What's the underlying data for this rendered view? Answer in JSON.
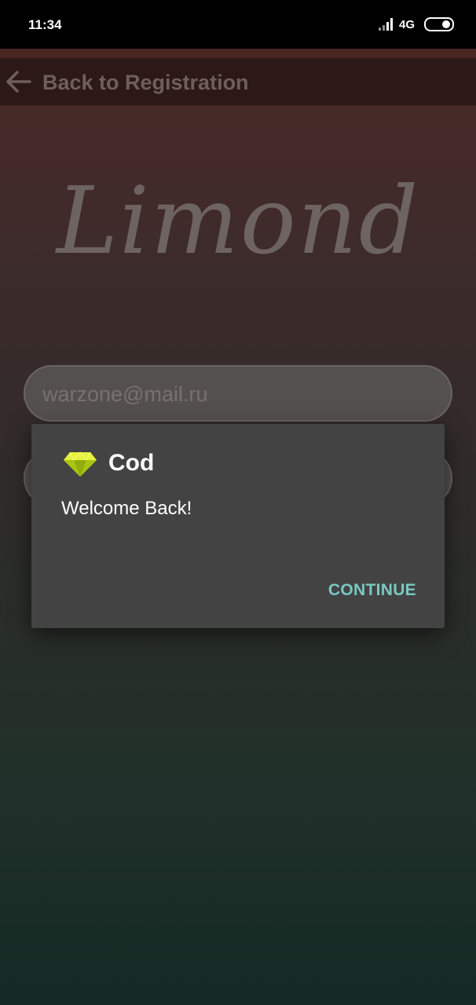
{
  "status_bar": {
    "time": "11:34",
    "network": "4G",
    "icons": [
      "signal-icon",
      "battery-icon"
    ]
  },
  "header": {
    "back_icon": "arrow-left-icon",
    "title": "Back to Registration"
  },
  "logo": {
    "text": "Limond"
  },
  "form": {
    "email_value": "warzone@mail.ru"
  },
  "dialog": {
    "icon": "diamond-icon",
    "title": "Cod",
    "message": "Welcome Back!",
    "button_label": "CONTINUE",
    "accent_color": "#79c9c3"
  }
}
